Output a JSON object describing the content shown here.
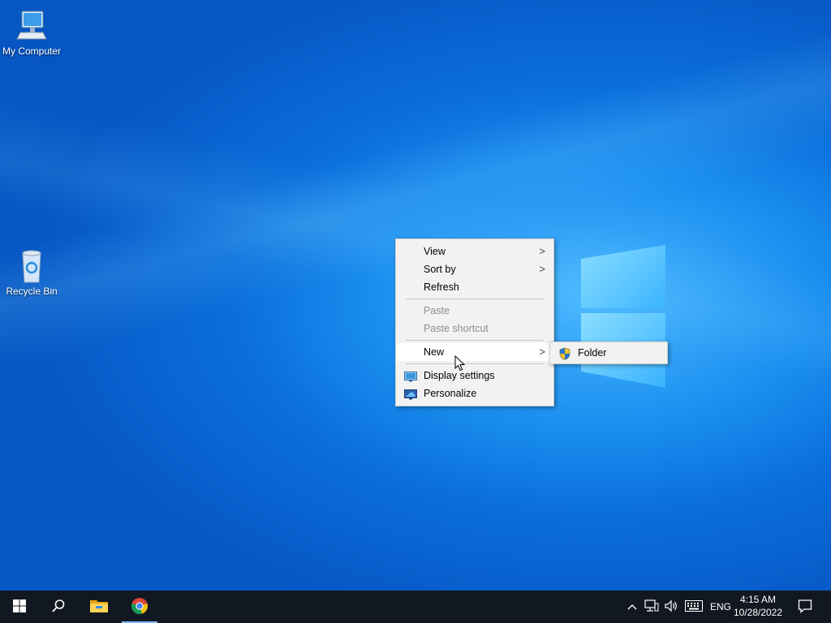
{
  "desktop": {
    "icons": [
      {
        "label": "My Computer",
        "icon": "computer-icon"
      },
      {
        "label": "Recycle Bin",
        "icon": "recycle-bin-icon"
      }
    ]
  },
  "context_menu": {
    "items": {
      "view": "View",
      "sort_by": "Sort by",
      "refresh": "Refresh",
      "paste": "Paste",
      "paste_shortcut": "Paste shortcut",
      "new": "New",
      "display_settings": "Display settings",
      "personalize": "Personalize"
    },
    "submenu": {
      "folder": "Folder"
    }
  },
  "taskbar": {
    "language": "ENG",
    "time": "4:15 AM",
    "date": "10/28/2022",
    "apps": [
      "start-icon",
      "search-icon",
      "file-explorer-icon",
      "chrome-icon"
    ]
  },
  "colors": {
    "taskbar_bg": "#121821",
    "menu_bg": "#f2f2f2",
    "accent": "#0b6fdc"
  }
}
